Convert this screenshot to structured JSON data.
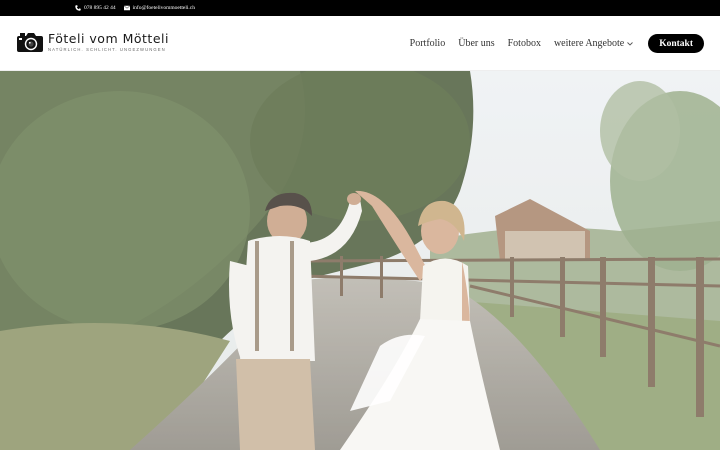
{
  "topbar": {
    "phone": "078 895 42 44",
    "email": "info@foetelivommoetteli.ch",
    "phone_icon": "phone-icon",
    "email_icon": "envelope-icon"
  },
  "logo": {
    "title": "Föteli vom Mötteli",
    "tagline": "NATÜRLICH. SCHLICHT. UNGEZWUNGEN",
    "icon": "camera-icon"
  },
  "nav": {
    "items": [
      {
        "label": "Portfolio"
      },
      {
        "label": "Über uns"
      },
      {
        "label": "Fotobox"
      },
      {
        "label": "weitere Angebote"
      }
    ],
    "cta": "Kontakt"
  },
  "hero": {
    "image": "wedding couple dancing on a country path"
  },
  "colors": {
    "topbar_bg": "#000000",
    "cta_bg": "#000000",
    "nav_text": "#333333"
  }
}
